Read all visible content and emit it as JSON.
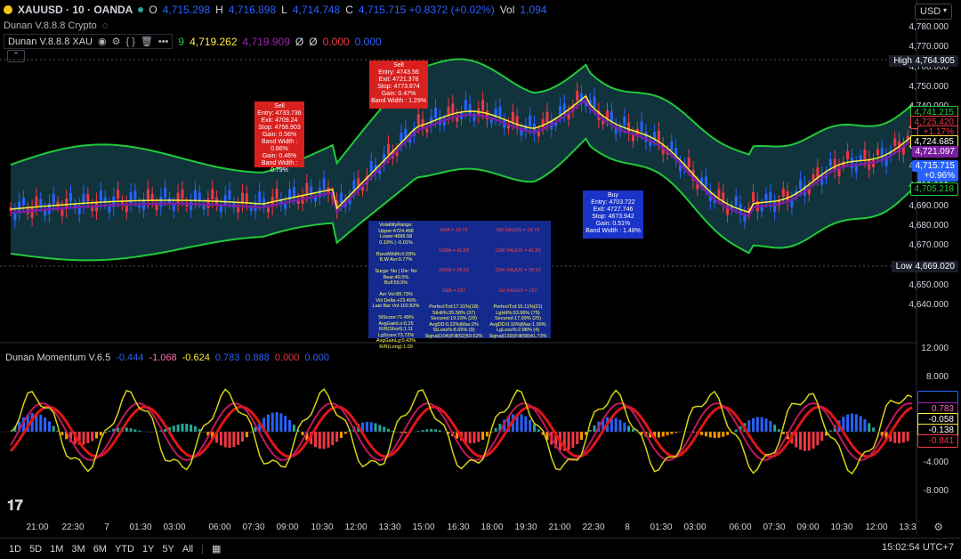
{
  "header": {
    "symbol": "XAUUSD · 10 · OANDA",
    "o_label": "O",
    "o_value": "4,715.298",
    "h_label": "H",
    "h_value": "4,716.898",
    "l_label": "L",
    "l_value": "4,714.748",
    "c_label": "C",
    "c_value": "4,715.715 +0.8372 (+0.02%)",
    "vol_label": "Vol",
    "vol_value": "1,094",
    "sub_name": "Dunan V.8.8.8 Crypto",
    "currency": "USD"
  },
  "indicator": {
    "name": "Dunan V.8.8.8 XAU",
    "v1": "9",
    "v2": "4,719.262",
    "v3": "4,719.909",
    "v4": "Ø",
    "v5": "Ø",
    "v6": "0.000",
    "v7": "0.000"
  },
  "price_axis": {
    "ticks": [
      "4,780.000",
      "4,770.000",
      "4,760.000",
      "4,750.000",
      "4,740.000",
      "4,730.000",
      "4,720.000",
      "4,710.000",
      "4,700.000",
      "4,690.000",
      "4,680.000",
      "4,670.000",
      "4,660.000",
      "4,650.000",
      "4,640.000"
    ],
    "high_label": "High",
    "high_value": "4,764.905",
    "low_label": "Low",
    "low_value": "4,669.020",
    "tag_1": "4,741.215",
    "tag_2": "4,725.420",
    "tag_3": "+1.17%",
    "tag_4": "4,724.685",
    "tag_5": "4,721.097",
    "tag_6": "4,715.715",
    "tag_7": "+0.96%",
    "tag_8": "4,705.218"
  },
  "momentum": {
    "title": "Dunan Momentum V.6.5",
    "v1": "-0.444",
    "v2": "-1.068",
    "v3": "-0.624",
    "v4": "0.783",
    "v5": "0.888",
    "v6": "0.000",
    "v7": "0.000",
    "ticks": [
      "12.000",
      "8.000",
      "4.000",
      "0.000",
      "-4.000",
      "-8.000"
    ],
    "tag_1": "0.783",
    "tag_2": "-0.058",
    "tag_3": "-0.138",
    "tag_4": "-0.841"
  },
  "time_axis": [
    "21:00",
    "22:30",
    "7",
    "01:30",
    "03:00",
    "06:00",
    "07:30",
    "09:00",
    "10:30",
    "12:00",
    "13:30",
    "15:00",
    "16:30",
    "18:00",
    "19:30",
    "21:00",
    "22:30",
    "8",
    "01:30",
    "03:00",
    "06:00",
    "07:30",
    "09:00",
    "10:30",
    "12:00",
    "13:3"
  ],
  "signals": {
    "sell1": {
      "title": "Sell",
      "entry": "Entry: 4733.736",
      "exit": "Exit: 4709.24",
      "stop": "Stop: 4756.903",
      "gain": "Gain: 0.56%",
      "band": "Band Width : 0.86%",
      "gain2": "Gain: 0.46%",
      "band2": "Band Width : 0.79%"
    },
    "sell2": {
      "title": "Sell",
      "entry": "Entry: 4743.56",
      "exit": "Exit: 4721.378",
      "stop": "Stop: 4773.674",
      "gain": "Gain: 0.47%",
      "band": "Band Width : 1.29%"
    },
    "buy": {
      "title": "Buy",
      "entry": "Entry: 4703.722",
      "exit": "Exit: 4727.746",
      "stop": "Stop: 4673.942",
      "gain": "Gain: 0.51%",
      "band": "Band Width : 1.48%"
    }
  },
  "table": {
    "left": [
      "VolatilityRange:",
      "Upper:4724.488",
      "Lower:4696.58",
      "0.19% | -0.01%",
      "",
      "BandWidth:0.59%",
      "B.W Avr:0.77%",
      "",
      "Surge: No | Div: No",
      "Bear:40.5%",
      "Bull:59.5%",
      "",
      "Avr Vol:89.73%",
      "Vol Delta:+23.46%",
      "Last Bar Vol:102.82%",
      "",
      "StScore:71.49%",
      "AvgGainLo:0.25",
      "R/R(Short):1.11",
      "LgScore:73.72%",
      "AvgGainLg:0.43%",
      "R/R(Long):1.09"
    ],
    "c1": [
      "5MA = 18.74",
      "10MA = 41.59",
      "15MA = 28.53",
      "1MA = 157"
    ],
    "c2": [
      "5M XAUUS = 18.74",
      "10M XAUUS = 41.59",
      "15M XAUUS = 28.53",
      "1H XAUUS = 157"
    ],
    "b1": [
      "PerfectTrd:17.31%(18)",
      "StHit%:35.58% (37)",
      "Secured:19.23% (20)",
      "AvgDD:0.22%|Max:2%",
      "StLoss%:8.65% (9)",
      "Signal(104)/Fill(62)59.62%"
    ],
    "b2": [
      "PerfectTrd:15.11%(21)",
      "LgHit%:53.96% (75)",
      "Secured:17.99% (25)",
      "AvgDD:0.16%|Max:1.99%",
      "LgLoss%:2.88% (4)",
      "Signal(139)/Fill(58)41.73%"
    ]
  },
  "timeframes": [
    "1D",
    "5D",
    "1M",
    "3M",
    "6M",
    "YTD",
    "1Y",
    "5Y",
    "All"
  ],
  "clock": "15:02:54 UTC+7",
  "colors": {
    "up": "#2962ff",
    "down": "#f23645",
    "band": "#22c93a",
    "mid": "#ffeb3b",
    "ma": "#7b1fa2"
  }
}
